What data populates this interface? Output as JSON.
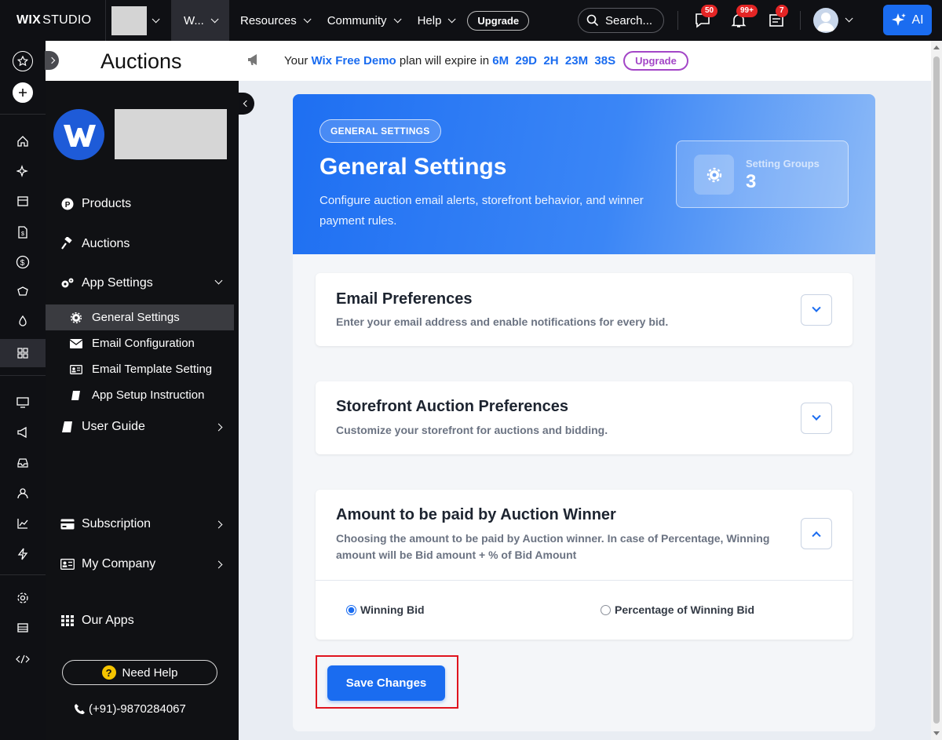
{
  "topbar": {
    "logo_bold": "WIX",
    "logo_rest": "STUDIO",
    "site_menu_label": "W...",
    "menu": [
      "Resources",
      "Community",
      "Help"
    ],
    "upgrade": "Upgrade",
    "search_placeholder": "Search...",
    "badges": {
      "messages": "50",
      "notifications": "99+",
      "updates": "7"
    },
    "ai_label": "AI"
  },
  "panel": {
    "title": "Auctions",
    "nav": {
      "products": "Products",
      "auctions": "Auctions",
      "app_settings": "App Settings",
      "general_settings": "General Settings",
      "email_configuration": "Email Configuration",
      "email_template_setting": "Email Template Setting",
      "app_setup_instruction": "App Setup Instruction",
      "user_guide": "User Guide",
      "subscription": "Subscription",
      "my_company": "My Company",
      "our_apps": "Our Apps"
    },
    "need_help": "Need Help",
    "phone": "(+91)-9870284067"
  },
  "banner": {
    "prefix": "Your",
    "plan": "Wix Free Demo",
    "middle": "plan will expire in",
    "countdown": [
      "6M",
      "29D",
      "2H",
      "23M",
      "38S"
    ],
    "upgrade": "Upgrade"
  },
  "hero": {
    "pill": "GENERAL SETTINGS",
    "title": "General Settings",
    "description": "Configure auction email alerts, storefront behavior, and winner payment rules.",
    "stat_label": "Setting Groups",
    "stat_value": "3"
  },
  "sections": {
    "email": {
      "title": "Email Preferences",
      "description": "Enter your email address and enable notifications for every bid."
    },
    "storefront": {
      "title": "Storefront Auction Preferences",
      "description": "Customize your storefront for auctions and bidding."
    },
    "winner": {
      "title": "Amount to be paid by Auction Winner",
      "description": "Choosing the amount to be paid by Auction winner. In case of Percentage, Winning amount will be Bid amount + % of Bid Amount",
      "options": [
        "Winning Bid",
        "Percentage of Winning Bid"
      ],
      "selected": "Winning Bid"
    }
  },
  "save_button": "Save Changes",
  "colors": {
    "accent": "#1a6cf0",
    "highlight_frame": "#e0141e",
    "upgrade_purple": "#a346c7",
    "badge_red": "#e42525"
  }
}
